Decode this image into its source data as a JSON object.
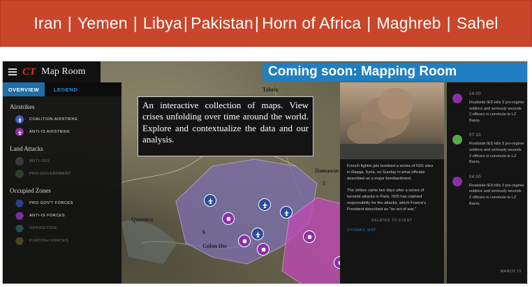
{
  "nav": {
    "items": [
      "Iran",
      "Yemen",
      "Libya",
      "Pakistan",
      "Horn of Africa",
      "Maghreb",
      "Sahel"
    ],
    "separators": [
      "|",
      "|",
      "|",
      "|",
      "|",
      "|"
    ]
  },
  "app": {
    "logo": "CT",
    "name": "Map Room",
    "hamburger_icon": "menu-icon"
  },
  "ribbon": {
    "text": "Coming soon: Mapping Room",
    "color": "#1f7fc1"
  },
  "left_panel": {
    "tabs": {
      "active": "OVERVIEW",
      "inactive": "LEGEND"
    },
    "sections": {
      "airstrikes": {
        "title": "Airstrikes",
        "items": [
          "COALITION AIRSTRIKE",
          "ANTI-IS AIRSTRIKE"
        ]
      },
      "land_attacks": {
        "title": "Land Attacks",
        "items": [
          "ANTI-ISIS",
          "PRO-GOVERNMENT"
        ]
      },
      "occupied_zones": {
        "title": "Occupied Zones",
        "items": [
          "PRO-GOV'T FORCES",
          "ANTI-IS FORCES",
          "OPPOSITION",
          "KURDISH FORCES"
        ]
      }
    },
    "colors": {
      "coalition": "#3a5bbf",
      "anti_is": "#8b2fa8",
      "dim": "#4a4a4a",
      "hex_dark_blue": "#2a3f8f",
      "hex_purple": "#7b2fa0",
      "hex_teal": "#1f4f4f",
      "hex_olive": "#4a4620"
    }
  },
  "overlay": {
    "text": "An interactive collection of maps. View crises unfolding over time around the world. Explore and contextualize the data and our analysis."
  },
  "map_labels": {
    "tabriz": "Tabriz",
    "damascus": "Damascus",
    "quneitra": "Quneitra",
    "golan": "Golan Hts",
    "a5": "5",
    "a6": "6"
  },
  "article": {
    "para1": "French fighter jets bombed a series of ISIS sites in Raqqa, Syria, on Sunday in what officials described as a major bombardment.",
    "para2": "The strikes came two days after a series of terrorist attacks in Paris. ISIS has claimed responsibility for the attacks, which France's President described as \"an act of war.\"",
    "related": "RELATED TO EVENT",
    "dynamic": "DYNAMIC MAP"
  },
  "timeline": {
    "items": [
      {
        "time": "14:00",
        "text": "Roadside IED kills 3 pro-regime soldiers and seriously wounds 2 officers in commute to LZ Basra.",
        "icon": "purple"
      },
      {
        "time": "07:10",
        "text": "Roadside IED kills 3 pro-regime soldiers and seriously wounds 2 officers in commute to LZ Basra.",
        "icon": "green"
      },
      {
        "time": "04:00",
        "text": "Roadside IED kills 3 pro-regime soldiers and seriously wounds 2 officers in commute to LZ Basra.",
        "icon": "purple"
      }
    ],
    "more": "MARCH 15"
  }
}
